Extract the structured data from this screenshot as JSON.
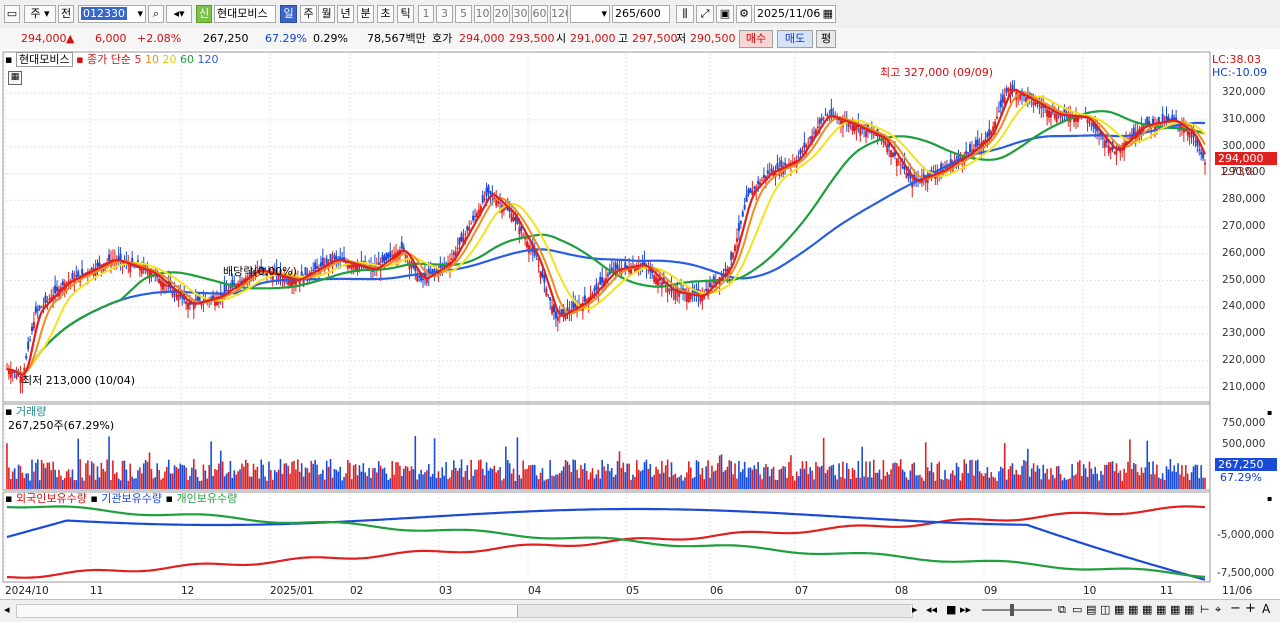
{
  "toolbar": {
    "period": "주",
    "adj": "전",
    "code": "012330",
    "shin": "신",
    "name": "현대모비스",
    "tabs": [
      "일",
      "주",
      "월",
      "년",
      "분",
      "초",
      "틱"
    ],
    "nums": [
      "1",
      "3",
      "5",
      "10",
      "20",
      "30",
      "60",
      "120"
    ],
    "count": "265",
    "total": "/600",
    "date": "2025/11/06"
  },
  "info": {
    "price": "294,000",
    "up": "▲",
    "change": "6,000",
    "rate": "+2.08%",
    "volume": "267,250",
    "volrate": "67.29%",
    "turnover": "0.29%",
    "amount": "78,567백만",
    "bidlbl": "호가",
    "bid1": "294,000",
    "bid2": "293,500",
    "openlbl": "시",
    "open": "291,000",
    "highlbl": "고",
    "high": "297,500",
    "lowlbl": "저",
    "low": "290,500",
    "buy": "매수",
    "sell": "매도",
    "avg": "평"
  },
  "legend": {
    "stock": "현대모비스",
    "ma_label": "종가 단순",
    "ma5": "5",
    "ma10": "10",
    "ma20": "20",
    "ma60": "60",
    "ma120": "120"
  },
  "annot": {
    "high": "최고 327,000 (09/09)",
    "low": "최저 213,000 (10/04)",
    "div": "배당락(0.00%)",
    "lc": "LC:38.03",
    "hc": "HC:-10.09",
    "price": "294,000",
    "pct": "1.73%"
  },
  "vol": {
    "title": "거래량",
    "info": "267,250주(67.29%)",
    "price": "267,250",
    "pct": "67.29%"
  },
  "hold": {
    "t1": "외국인보유수량",
    "t2": "기관보유수량",
    "t3": "개인보유수량"
  },
  "colors": {
    "up": "#e02020",
    "down": "#1a4bd6",
    "ma5": "#e02020",
    "ma10": "#f08c1a",
    "ma20": "#f5e21a",
    "ma60": "#1e9e3c",
    "ma120": "#2a5ee0"
  },
  "chart_data": {
    "type": "line",
    "title": "현대모비스",
    "xlabel": "",
    "ylabel": "",
    "ylim": [
      205000,
      335000
    ],
    "yticks": [
      "320,000",
      "310,000",
      "300,000",
      "290,000",
      "280,000",
      "270,000",
      "260,000",
      "250,000",
      "240,000",
      "230,000",
      "220,000",
      "210,000"
    ],
    "yvals": [
      320000,
      310000,
      300000,
      290000,
      280000,
      270000,
      260000,
      250000,
      240000,
      230000,
      220000,
      210000
    ],
    "x_labels": [
      "2024/10",
      "11",
      "12",
      "2025/01",
      "02",
      "03",
      "04",
      "05",
      "06",
      "07",
      "08",
      "09",
      "10",
      "11",
      "11/06"
    ],
    "price_keypoints": [
      [
        0,
        217000
      ],
      [
        8,
        214000
      ],
      [
        15,
        238000
      ],
      [
        30,
        249000
      ],
      [
        55,
        258000
      ],
      [
        75,
        253000
      ],
      [
        95,
        241000
      ],
      [
        110,
        244000
      ],
      [
        130,
        254000
      ],
      [
        150,
        250000
      ],
      [
        170,
        258000
      ],
      [
        190,
        254000
      ],
      [
        205,
        262000
      ],
      [
        215,
        250000
      ],
      [
        230,
        257000
      ],
      [
        250,
        283000
      ],
      [
        262,
        275000
      ],
      [
        275,
        258000
      ],
      [
        285,
        236000
      ],
      [
        300,
        242000
      ],
      [
        315,
        254000
      ],
      [
        330,
        256000
      ],
      [
        345,
        246000
      ],
      [
        360,
        244000
      ],
      [
        375,
        255000
      ],
      [
        385,
        282000
      ],
      [
        395,
        290000
      ],
      [
        410,
        295000
      ],
      [
        425,
        312000
      ],
      [
        440,
        308000
      ],
      [
        455,
        303000
      ],
      [
        470,
        287000
      ],
      [
        485,
        291000
      ],
      [
        500,
        298000
      ],
      [
        510,
        304000
      ],
      [
        520,
        322000
      ],
      [
        530,
        318000
      ],
      [
        545,
        312000
      ],
      [
        560,
        311000
      ],
      [
        575,
        298000
      ],
      [
        590,
        308000
      ],
      [
        605,
        310000
      ],
      [
        615,
        305000
      ],
      [
        622,
        294000
      ]
    ],
    "vol_ticks": [
      "750,000",
      "500,000"
    ],
    "hold_ticks": [
      "-5,000,000",
      "-7,500,000"
    ]
  }
}
